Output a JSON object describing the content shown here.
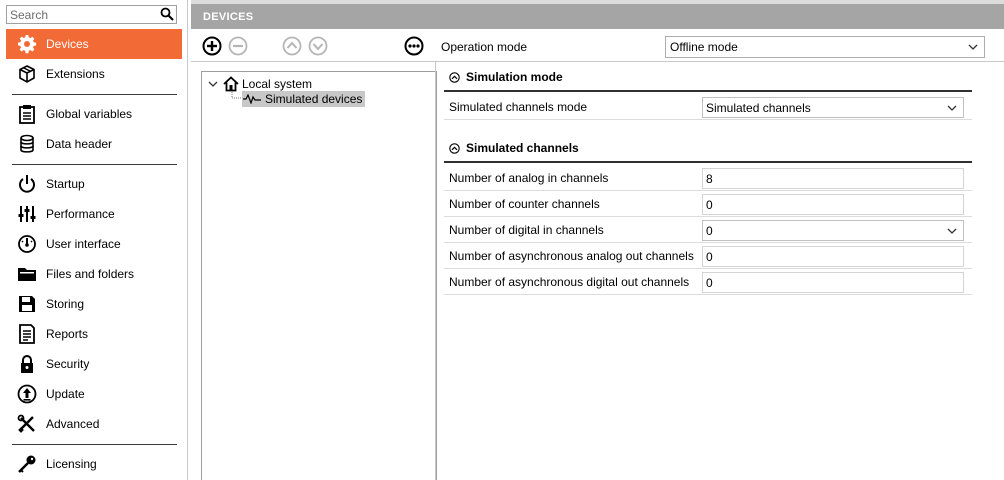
{
  "sidebar": {
    "search": {
      "placeholder": "Search",
      "value": ""
    },
    "groups": [
      [
        {
          "label": "Devices",
          "icon": "gear-icon",
          "active": true
        },
        {
          "label": "Extensions",
          "icon": "cube-icon"
        }
      ],
      [
        {
          "label": "Global variables",
          "icon": "clipboard-icon"
        },
        {
          "label": "Data header",
          "icon": "database-icon"
        }
      ],
      [
        {
          "label": "Startup",
          "icon": "power-icon"
        },
        {
          "label": "Performance",
          "icon": "sliders-icon"
        },
        {
          "label": "User interface",
          "icon": "gauge-icon"
        },
        {
          "label": "Files and folders",
          "icon": "folder-icon"
        },
        {
          "label": "Storing",
          "icon": "floppy-icon"
        },
        {
          "label": "Reports",
          "icon": "report-icon"
        },
        {
          "label": "Security",
          "icon": "lock-icon"
        },
        {
          "label": "Update",
          "icon": "update-icon"
        },
        {
          "label": "Advanced",
          "icon": "tools-icon"
        }
      ],
      [
        {
          "label": "Licensing",
          "icon": "key-icon"
        }
      ]
    ]
  },
  "header": {
    "title": "DEVICES"
  },
  "toolbar": {
    "operation_mode_label": "Operation mode",
    "operation_mode_value": "Offline mode"
  },
  "tree": {
    "root": {
      "label": "Local system",
      "icon": "home-icon",
      "expanded": true
    },
    "children": [
      {
        "label": "Simulated devices",
        "icon": "signal-icon",
        "selected": true
      }
    ]
  },
  "properties": {
    "sections": [
      {
        "title": "Simulation mode",
        "rows": [
          {
            "label": "Simulated channels mode",
            "value": "Simulated channels",
            "dropdown": true
          }
        ]
      },
      {
        "title": "Simulated channels",
        "rows": [
          {
            "label": "Number of analog in channels",
            "value": "8",
            "dropdown": false
          },
          {
            "label": "Number of counter channels",
            "value": "0",
            "dropdown": false
          },
          {
            "label": "Number of digital in channels",
            "value": "0",
            "dropdown": true
          },
          {
            "label": "Number of asynchronous analog out channels",
            "value": "0",
            "dropdown": false
          },
          {
            "label": "Number of asynchronous digital out channels",
            "value": "0",
            "dropdown": false
          }
        ]
      }
    ]
  },
  "colors": {
    "accent": "#f26a35",
    "header_bar": "#a5a5a5"
  }
}
